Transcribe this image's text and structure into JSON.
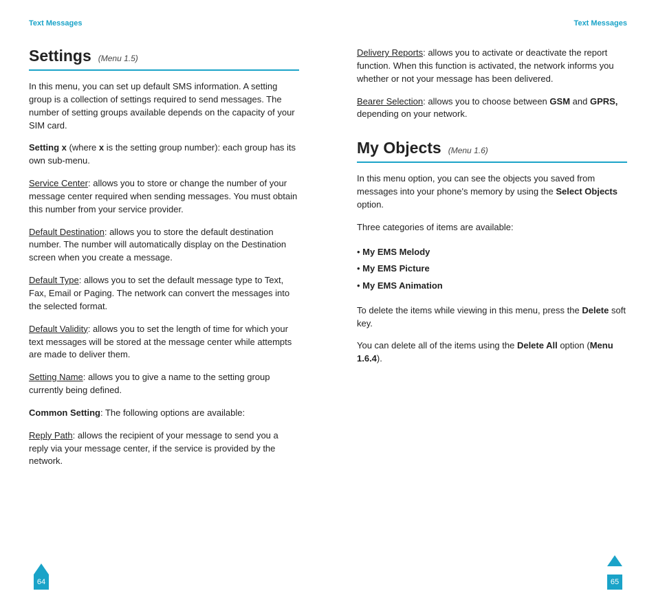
{
  "left": {
    "header": "Text Messages",
    "title": "Settings",
    "menu": "(Menu 1.5)",
    "intro": "In this menu, you can set up default SMS information. A setting group is a collection of settings required to send messages. The number of setting groups available depends on the capacity of your SIM card.",
    "settingx_b1": "Setting x",
    "settingx_mid": " (where ",
    "settingx_b2": "x",
    "settingx_tail": " is the setting group number): each group has its own sub-menu.",
    "sc_label": "Service Center",
    "sc_body": ": allows you to store or change the number of your message center required when sending messages. You must obtain this number from your service provider.",
    "dd_label": "Default Destination",
    "dd_body": ": allows you to store the default destination number. The number will automatically display on the Destination screen when you create a message.",
    "dt_label": "Default Type",
    "dt_body": ": allows you to set the default message type to Text, Fax, Email or Paging. The network can convert the messages into the selected format.",
    "dv_label": "Default Validity",
    "dv_body": ": allows you to set the length of time for which your text messages will be stored at the message center while attempts are made to deliver them.",
    "sn_label": "Setting Name",
    "sn_body": ": allows you to give a name to the setting group currently being defined.",
    "cs_label": "Common Setting",
    "cs_body": ": The following options are available:",
    "rp_label": "Reply Path",
    "rp_body": ": allows the recipient of your message to send you a reply via your message center, if the service is provided by the network.",
    "pagenum": "64"
  },
  "right": {
    "header": "Text Messages",
    "dr_label": "Delivery Reports",
    "dr_body": ": allows you to activate or deactivate the report function. When this function is activated, the network informs you whether or not your message has been delivered.",
    "bs_label": "Bearer Selection",
    "bs_pre": ": allows you to choose between ",
    "bs_gsm": "GSM",
    "bs_and": " and ",
    "bs_gprs": "GPRS,",
    "bs_tail": " depending on your network.",
    "title": "My Objects",
    "menu": "(Menu 1.6)",
    "intro_pre": "In this menu option, you can see the objects you saved from messages into your phone's memory by using the ",
    "intro_b": "Select Objects",
    "intro_tail": " option.",
    "three": "Three categories of items are available:",
    "li1": "My EMS Melody",
    "li2": "My EMS Picture",
    "li3": "My EMS Animation",
    "del_pre": "To delete the items while viewing in this menu, press the ",
    "del_b": "Delete",
    "del_tail": " soft key.",
    "da_pre": "You can delete all of the items using the ",
    "da_b": "Delete All",
    "da_mid": " option (",
    "da_menu": "Menu 1.6.4",
    "da_tail": ").",
    "pagenum": "65"
  }
}
